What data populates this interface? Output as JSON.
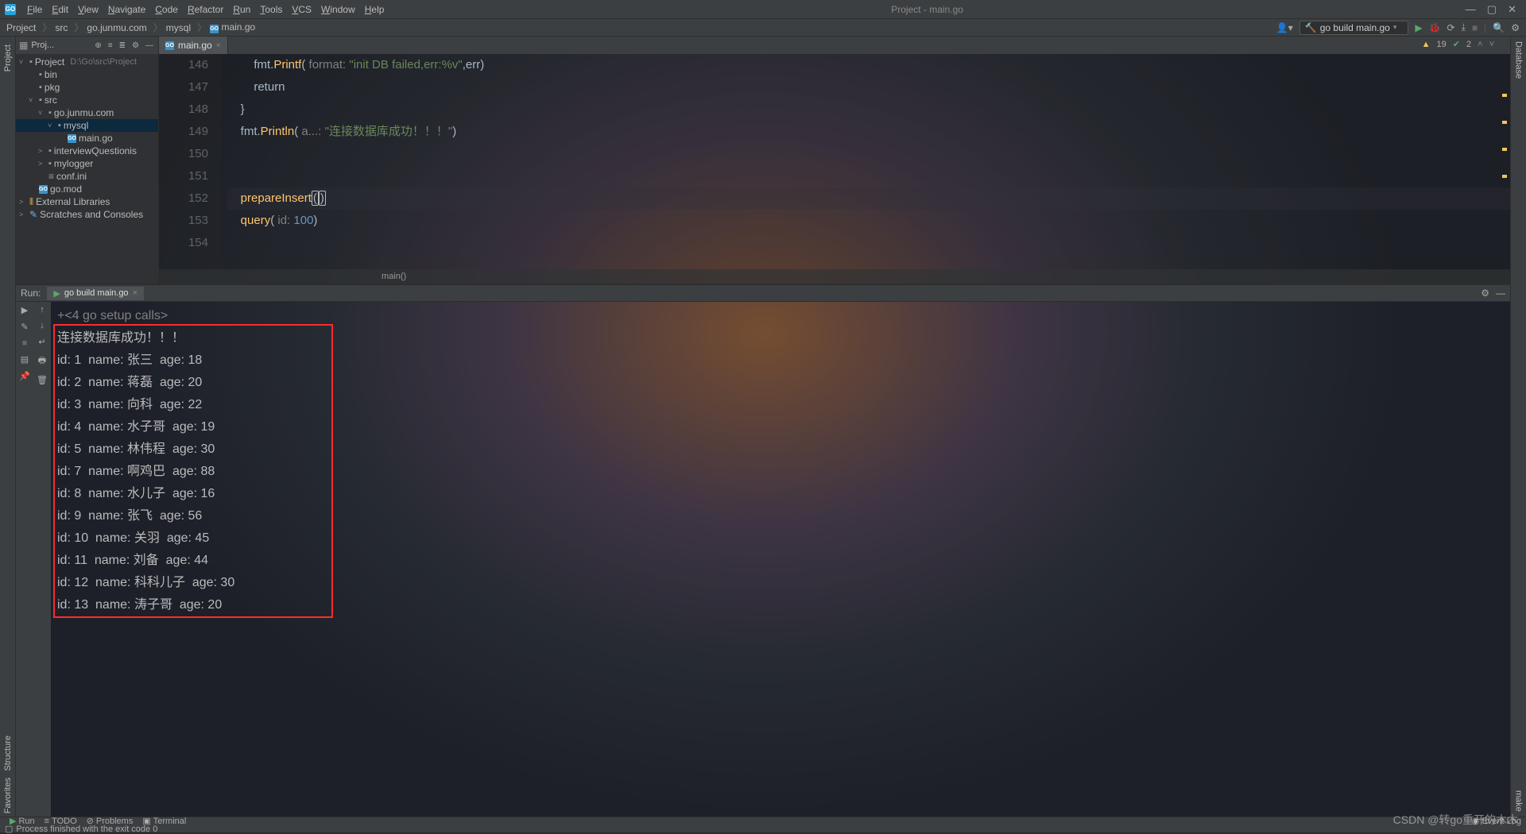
{
  "window": {
    "title": "Project - main.go"
  },
  "menu": [
    "File",
    "Edit",
    "View",
    "Navigate",
    "Code",
    "Refactor",
    "Run",
    "Tools",
    "VCS",
    "Window",
    "Help"
  ],
  "breadcrumb": [
    "Project",
    "src",
    "go.junmu.com",
    "mysql",
    "main.go"
  ],
  "run_config": {
    "label": "go build main.go"
  },
  "project_tool": {
    "title": "Proj...",
    "tree": {
      "root": {
        "label": "Project",
        "path": "D:\\Go\\src\\Project"
      },
      "items": [
        {
          "indent": 1,
          "arrow": "",
          "icon": "folder",
          "label": "bin"
        },
        {
          "indent": 1,
          "arrow": "",
          "icon": "folder",
          "label": "pkg"
        },
        {
          "indent": 1,
          "arrow": "v",
          "icon": "folder",
          "label": "src"
        },
        {
          "indent": 2,
          "arrow": "v",
          "icon": "folder",
          "label": "go.junmu.com"
        },
        {
          "indent": 3,
          "arrow": "v",
          "icon": "folder",
          "label": "mysql",
          "selected": true
        },
        {
          "indent": 4,
          "arrow": "",
          "icon": "go",
          "label": "main.go"
        },
        {
          "indent": 2,
          "arrow": ">",
          "icon": "folder",
          "label": "interviewQuestionis"
        },
        {
          "indent": 2,
          "arrow": ">",
          "icon": "folder",
          "label": "mylogger"
        },
        {
          "indent": 2,
          "arrow": "",
          "icon": "file",
          "label": "conf.ini"
        },
        {
          "indent": 1,
          "arrow": "",
          "icon": "go",
          "label": "go.mod"
        }
      ],
      "extra": [
        {
          "icon": "lib",
          "label": "External Libraries"
        },
        {
          "icon": "scratch",
          "label": "Scratches and Consoles"
        }
      ]
    }
  },
  "editor_tab": {
    "label": "main.go"
  },
  "editor": {
    "inspections": {
      "warnings": "19",
      "passes": "2"
    },
    "breadcrumb": "main()",
    "lines": [
      {
        "num": "146",
        "html": "        fmt.<span class='k-fn'>Printf</span>( <span class='k-param'>format:</span> <span class='k-str'>\"init DB failed,err:%v\"</span>,err)"
      },
      {
        "num": "147",
        "html": "        <span class='k-ident'>return</span>"
      },
      {
        "num": "148",
        "html": "    }"
      },
      {
        "num": "149",
        "html": "    fmt.<span class='k-fn'>Println</span>( <span class='k-param'>a...:</span> <span class='k-str'>\"连接数据库成功！！！\"</span>)"
      },
      {
        "num": "150",
        "html": ""
      },
      {
        "num": "151",
        "html": ""
      },
      {
        "num": "152",
        "html": "    <span class='k-call'>prepareInsert</span><span class='paren-hl'>(</span><span class='paren-hl'>)</span>",
        "active": true
      },
      {
        "num": "153",
        "html": "    <span class='k-call'>query</span>( <span class='k-param'>id:</span> <span class='k-num'>100</span>)"
      },
      {
        "num": "154",
        "html": ""
      }
    ]
  },
  "run": {
    "title": "Run:",
    "tab": "go build main.go",
    "setup_line": "<4 go setup calls>",
    "output": [
      "连接数据库成功！！！",
      "id: 1  name: 张三  age: 18",
      "id: 2  name: 蒋磊  age: 20",
      "id: 3  name: 向科  age: 22",
      "id: 4  name: 水子哥  age: 19",
      "id: 5  name: 林伟程  age: 30",
      "id: 7  name: 啊鸡巴  age: 88",
      "id: 8  name: 水儿子  age: 16",
      "id: 9  name: 张飞  age: 56",
      "id: 10  name: 关羽  age: 45",
      "id: 11  name: 刘备  age: 44",
      "id: 12  name: 科科儿子  age: 30",
      "id: 13  name: 涛子哥  age: 20"
    ]
  },
  "bottom_tabs": [
    "Run",
    "TODO",
    "Problems",
    "Terminal"
  ],
  "status": {
    "msg": "Process finished with the exit code 0",
    "event_log": "Event Log"
  },
  "left_tabs": [
    "Project",
    "Structure",
    "Favorites"
  ],
  "right_tabs": [
    "Database",
    "make"
  ],
  "watermark": "CSDN @转go重开的木木"
}
